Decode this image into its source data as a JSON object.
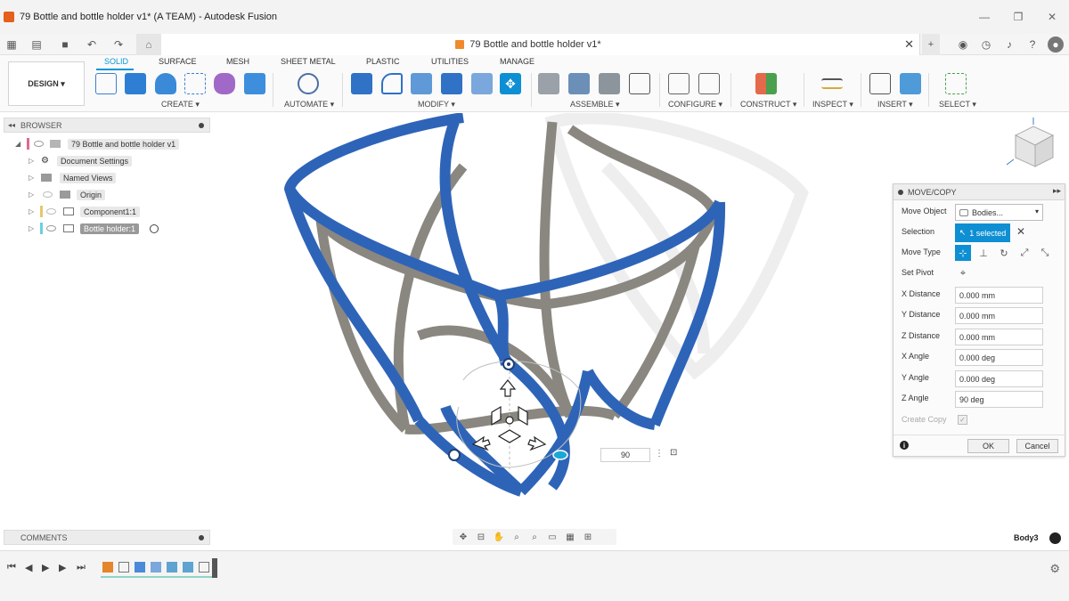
{
  "window": {
    "title": "79 Bottle and bottle holder v1* (A TEAM) - Autodesk Fusion",
    "controls": [
      "minimize-icon",
      "restore-icon",
      "close-icon"
    ]
  },
  "document_tab": {
    "title": "79 Bottle and bottle holder v1*",
    "close_label": "✕"
  },
  "ribbon": {
    "workspace": "DESIGN ▾",
    "tabs": [
      "SOLID",
      "SURFACE",
      "MESH",
      "SHEET METAL",
      "PLASTIC",
      "UTILITIES",
      "MANAGE"
    ],
    "active_tab": "SOLID",
    "groups": [
      "CREATE ▾",
      "AUTOMATE ▾",
      "MODIFY ▾",
      "ASSEMBLE ▾",
      "CONFIGURE ▾",
      "CONSTRUCT ▾",
      "INSPECT ▾",
      "INSERT ▾",
      "SELECT ▾"
    ],
    "accent": "#0696d7"
  },
  "browser": {
    "title": "BROWSER",
    "items": [
      {
        "label": "79 Bottle and bottle holder v1",
        "color": "#e06a8c"
      },
      {
        "label": "Document Settings"
      },
      {
        "label": "Named Views"
      },
      {
        "label": "Origin"
      },
      {
        "label": "Component1:1",
        "color": "#e8c76a"
      },
      {
        "label": "Bottle holder:1",
        "color": "#6ad0e0"
      }
    ]
  },
  "dialog": {
    "title": "MOVE/COPY",
    "move_object_label": "Move Object",
    "move_object_value": "Bodies...",
    "selection_label": "Selection",
    "selection_value": "1 selected",
    "move_type_label": "Move Type",
    "set_pivot_label": "Set Pivot",
    "x_distance_label": "X Distance",
    "x_distance_value": "0.000 mm",
    "y_distance_label": "Y Distance",
    "y_distance_value": "0.000 mm",
    "z_distance_label": "Z Distance",
    "z_distance_value": "0.000 mm",
    "x_angle_label": "X Angle",
    "x_angle_value": "0.000 deg",
    "y_angle_label": "Y Angle",
    "y_angle_value": "0.000 deg",
    "z_angle_label": "Z Angle",
    "z_angle_value": "90 deg",
    "create_copy_label": "Create Copy",
    "ok_label": "OK",
    "cancel_label": "Cancel",
    "accent": "#0e8fd3"
  },
  "viewport": {
    "rotation_input": "90",
    "active_body": "Body3",
    "model_blue": "#2e64b8",
    "model_gray": "#8a8780"
  },
  "comments": {
    "title": "COMMENTS"
  }
}
